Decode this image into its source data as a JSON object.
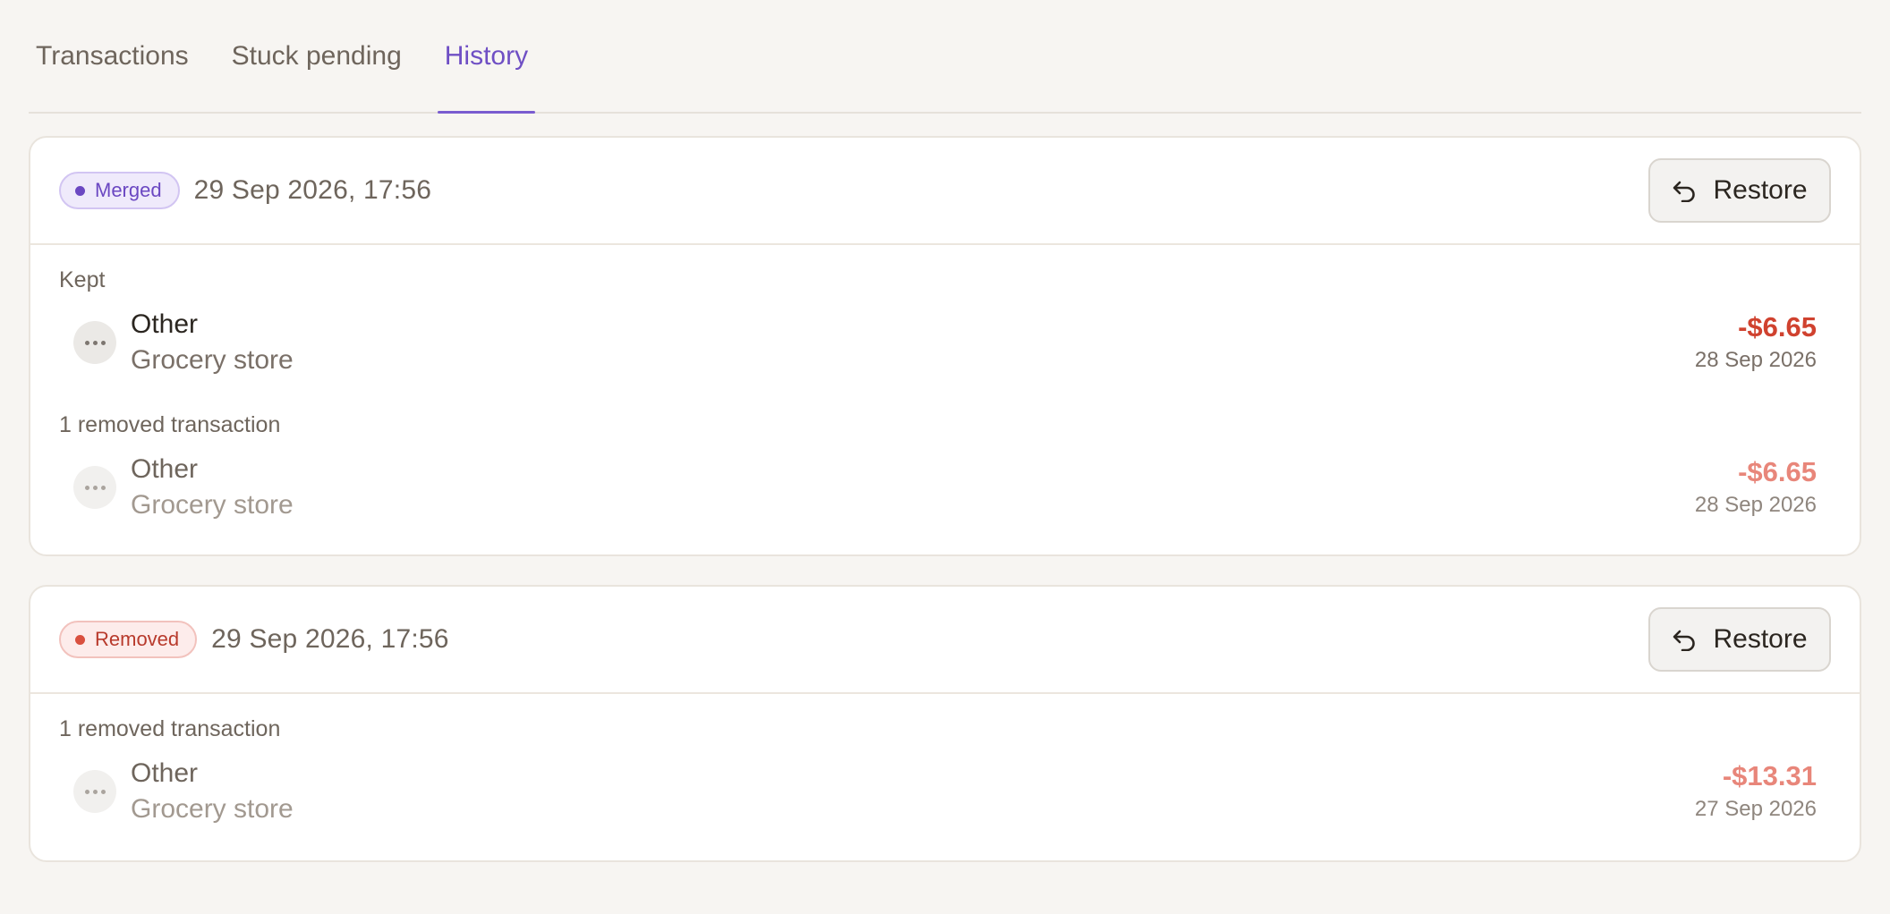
{
  "tabs": [
    {
      "label": "Transactions",
      "active": false
    },
    {
      "label": "Stuck pending",
      "active": false
    },
    {
      "label": "History",
      "active": true
    }
  ],
  "history": [
    {
      "status": "Merged",
      "timestamp": "29 Sep 2026, 17:56",
      "restore_label": "Restore",
      "kept_label": "Kept",
      "kept": {
        "name": "Other",
        "merchant": "Grocery store",
        "amount": "-$6.65",
        "date": "28 Sep 2026"
      },
      "removed_label": "1 removed transaction",
      "removed": [
        {
          "name": "Other",
          "merchant": "Grocery store",
          "amount": "-$6.65",
          "date": "28 Sep 2026"
        }
      ]
    },
    {
      "status": "Removed",
      "timestamp": "29 Sep 2026, 17:56",
      "restore_label": "Restore",
      "removed_label": "1 removed transaction",
      "removed": [
        {
          "name": "Other",
          "merchant": "Grocery store",
          "amount": "-$13.31",
          "date": "27 Sep 2026"
        }
      ]
    }
  ],
  "colors": {
    "accent": "#6f4fc4",
    "negative_amount": "#d0422f",
    "removed_badge": "#b83a2c"
  }
}
